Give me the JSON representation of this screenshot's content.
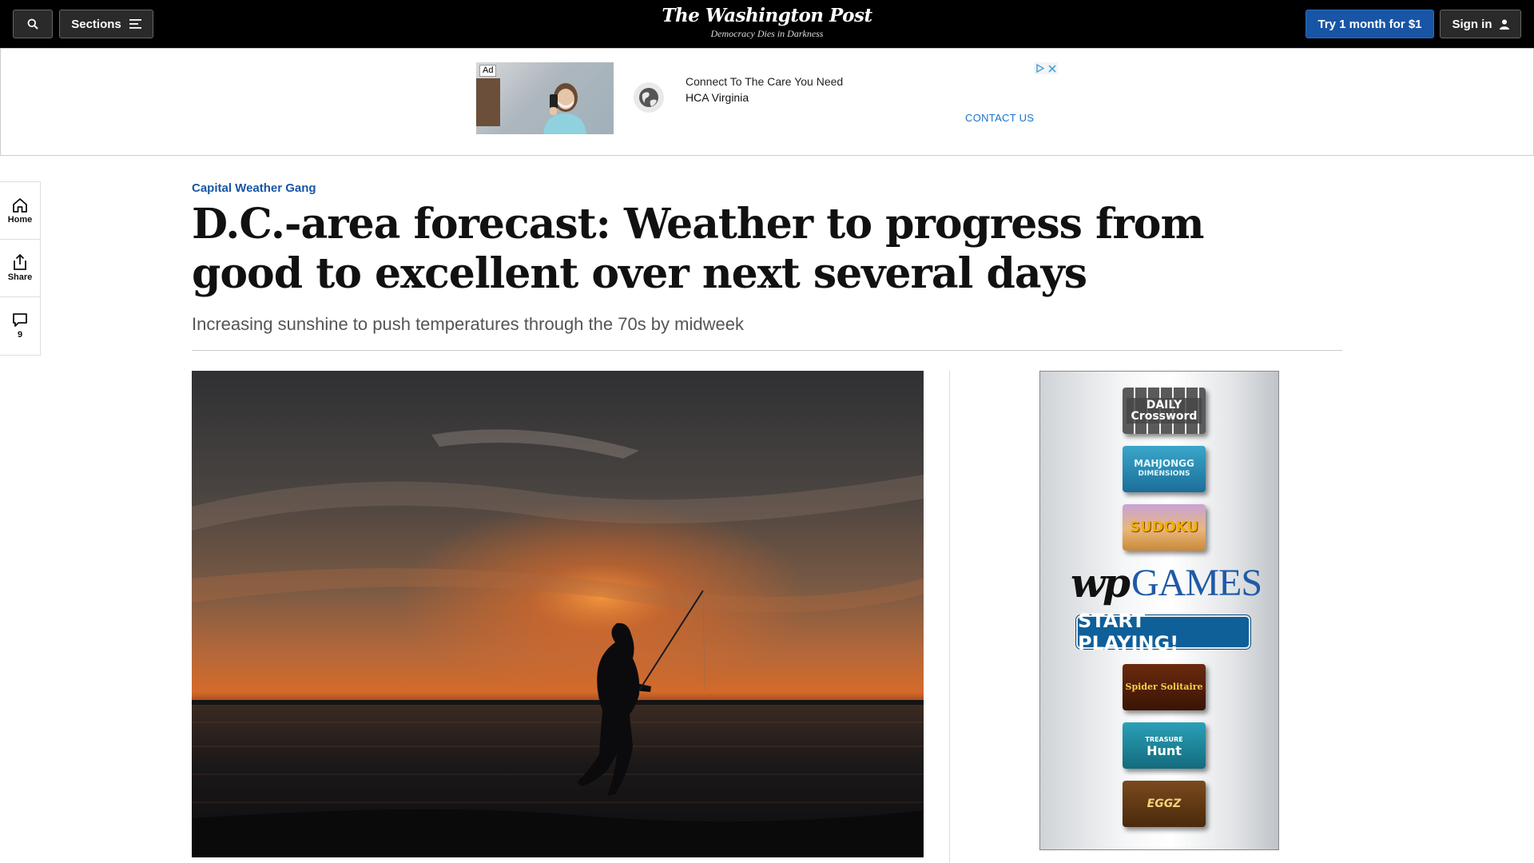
{
  "topbar": {
    "search_icon": "search-icon",
    "sections_label": "Sections",
    "logo": "The Washington Post",
    "tagline": "Democracy Dies in Darkness",
    "try_label": "Try 1 month for $1",
    "signin_label": "Sign in"
  },
  "ad_banner": {
    "tag": "Ad",
    "headline": "Connect To The Care You Need",
    "brand": "HCA Virginia",
    "cta": "CONTACT US"
  },
  "rail": {
    "home_label": "Home",
    "share_label": "Share",
    "comments_count": "9"
  },
  "article": {
    "kicker": "Capital Weather Gang",
    "headline": "D.C.-area forecast: Weather to progress from good to excellent over next several days",
    "dek": "Increasing sunshine to push temperatures through the 70s by midweek"
  },
  "games_ad": {
    "tiles": [
      {
        "line1": "DAILY",
        "line2": "Crossword"
      },
      {
        "line1": "MAHJONGG",
        "line2": "DIMENSIONS"
      },
      {
        "line1": "SUDOKU",
        "line2": ""
      }
    ],
    "brand_wp": "wp",
    "brand_games": "GAMES",
    "start_label": "START PLAYING!",
    "tiles_bottom": [
      {
        "line1": "Spider Solitaire",
        "line2": ""
      },
      {
        "line1": "TREASURE",
        "line2": "Hunt"
      },
      {
        "line1": "EGGZ",
        "line2": ""
      }
    ]
  },
  "colors": {
    "accent": "#1955a5",
    "topbar_bg": "#000000"
  }
}
